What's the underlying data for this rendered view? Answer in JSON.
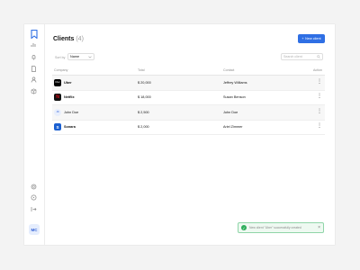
{
  "sidebar": {
    "logo_icon": "bookmark-logo-icon",
    "icons": [
      "chart-icon",
      "bell-icon",
      "document-icon",
      "user-icon",
      "box-icon"
    ],
    "bottom_icons": [
      "settings-icon",
      "help-icon",
      "logout-icon"
    ],
    "avatar_initials": "MC"
  },
  "header": {
    "title": "Clients",
    "count": "(4)",
    "new_button_label": "New client",
    "new_button_icon": "plus-icon"
  },
  "filters": {
    "sort_label": "Sort by",
    "sort_value": "Name",
    "search_placeholder": "Search client"
  },
  "table": {
    "columns": {
      "company": "Company",
      "total": "Total",
      "contact": "Contact",
      "action": "Action"
    },
    "rows": [
      {
        "logo_text": "Uber",
        "logo_color": "#000000",
        "company": "Uber",
        "total": "$ 20,000",
        "contact": "Jeffrey Williams",
        "action": "⋮"
      },
      {
        "logo_text": "N",
        "logo_color": "#111111",
        "company": "Netflix",
        "total": "$ 18,000",
        "contact": "Susan Benson",
        "action": "⋮"
      },
      {
        "logo_text": "JD",
        "logo_color": "#e8eefc",
        "company": "John Doe",
        "total": "$ 2,500",
        "contact": "John Doe",
        "action": "⋮"
      },
      {
        "logo_text": "S",
        "logo_color": "#1a5fd0",
        "company": "Sonara",
        "total": "$ 2,000",
        "contact": "Ariel Zimmer",
        "action": "⋮"
      }
    ]
  },
  "toast": {
    "message": "New client \"Uber\" successfully created",
    "close": "×"
  },
  "colors": {
    "accent": "#2f6fe4",
    "success": "#2eae5c"
  }
}
